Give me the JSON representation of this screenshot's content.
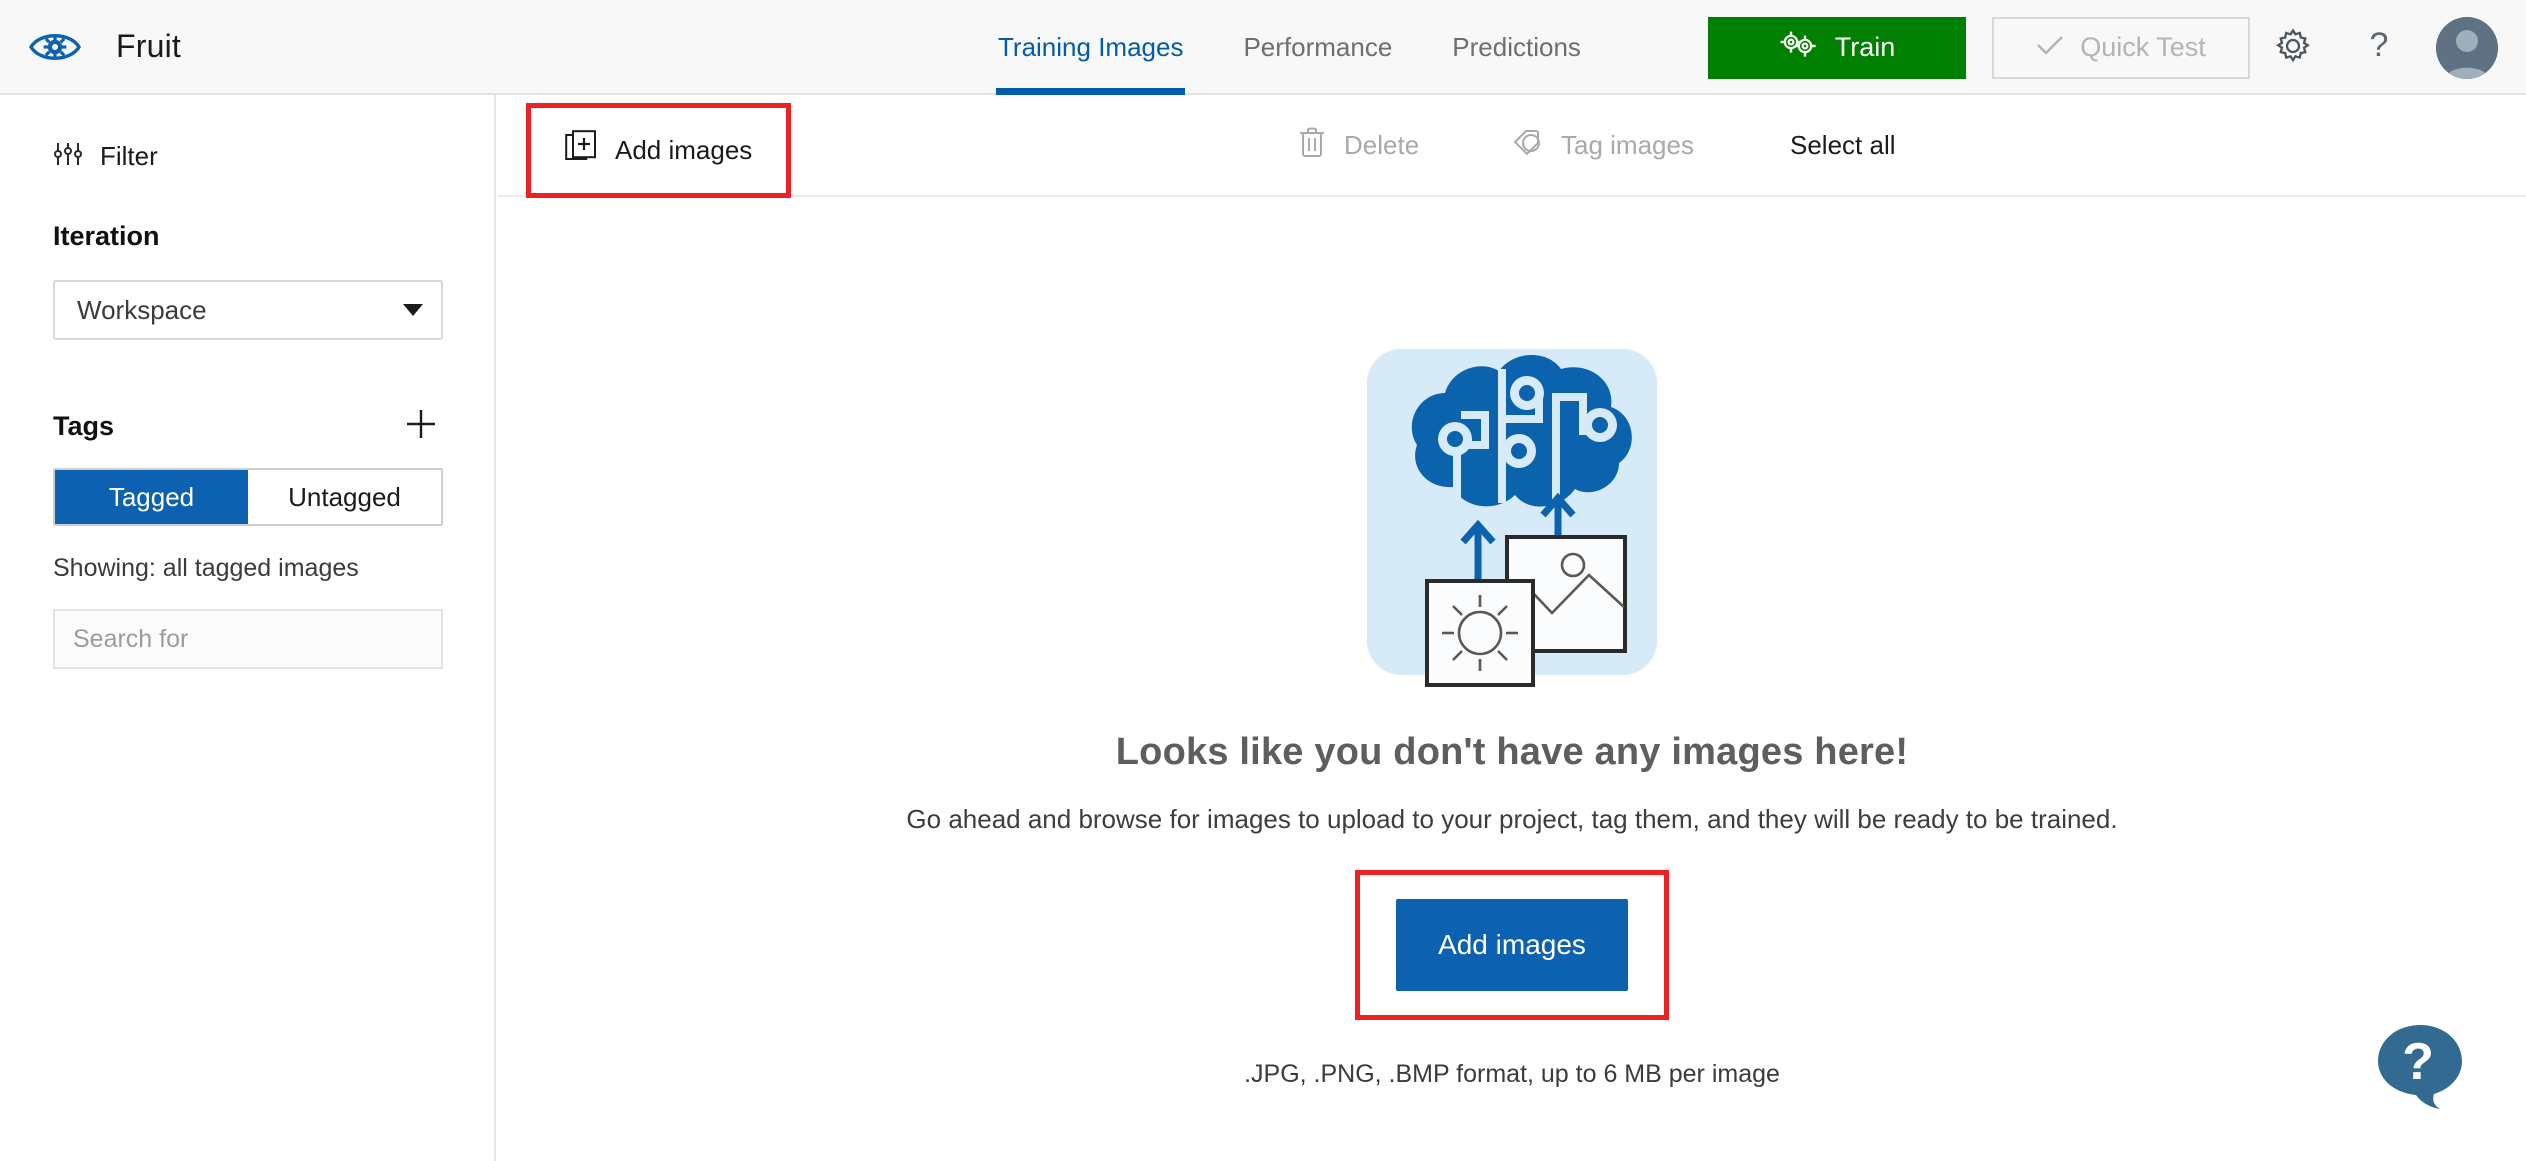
{
  "header": {
    "logo_icon": "eye-gear-logo",
    "project_title": "Fruit",
    "tabs": [
      {
        "label": "Training Images",
        "active": true
      },
      {
        "label": "Performance",
        "active": false
      },
      {
        "label": "Predictions",
        "active": false
      }
    ],
    "train_button": {
      "label": "Train",
      "icon": "gears-icon",
      "color": "#008000"
    },
    "quick_test_button": {
      "label": "Quick Test",
      "icon": "check-icon",
      "disabled": true
    },
    "settings_icon": "gear-icon",
    "help_icon": "question-mark-icon",
    "avatar": "user-avatar"
  },
  "sidebar": {
    "filter": {
      "label": "Filter",
      "icon": "sliders-icon"
    },
    "iteration": {
      "title": "Iteration",
      "selected": "Workspace",
      "options": [
        "Workspace"
      ]
    },
    "tags": {
      "title": "Tags",
      "add_icon": "plus-icon",
      "toggle": [
        {
          "label": "Tagged",
          "selected": true
        },
        {
          "label": "Untagged",
          "selected": false
        }
      ],
      "showing_text": "Showing: all tagged images",
      "search_placeholder": "Search for",
      "search_value": ""
    }
  },
  "toolbar": {
    "add_images": {
      "label": "Add images",
      "icon": "add-images-icon",
      "enabled": true,
      "highlighted": true
    },
    "delete": {
      "label": "Delete",
      "icon": "trash-icon",
      "enabled": false
    },
    "tag_images": {
      "label": "Tag images",
      "icon": "tag-icon",
      "enabled": false
    },
    "select_all": {
      "label": "Select all",
      "enabled": true
    }
  },
  "empty_state": {
    "illustration": "brain-cloud-images-illustration",
    "title": "Looks like you don't have any images here!",
    "subtitle": "Go ahead and browse for images to upload to your project, tag them, and they will be ready to be trained.",
    "add_button_label": "Add images",
    "add_button_highlighted": true,
    "format_note": ".JPG, .PNG, .BMP format, up to 6 MB per image"
  },
  "help_fab": {
    "icon": "help-chat-bubble-icon"
  },
  "colors": {
    "accent_blue": "#0c62b0",
    "tab_active_blue": "#015cab",
    "train_green": "#008000",
    "annotation_red": "#ee2222",
    "illustration_blue": "#0b63ae",
    "illustration_bg": "#d7eaf7",
    "help_bubble": "#336a91"
  }
}
